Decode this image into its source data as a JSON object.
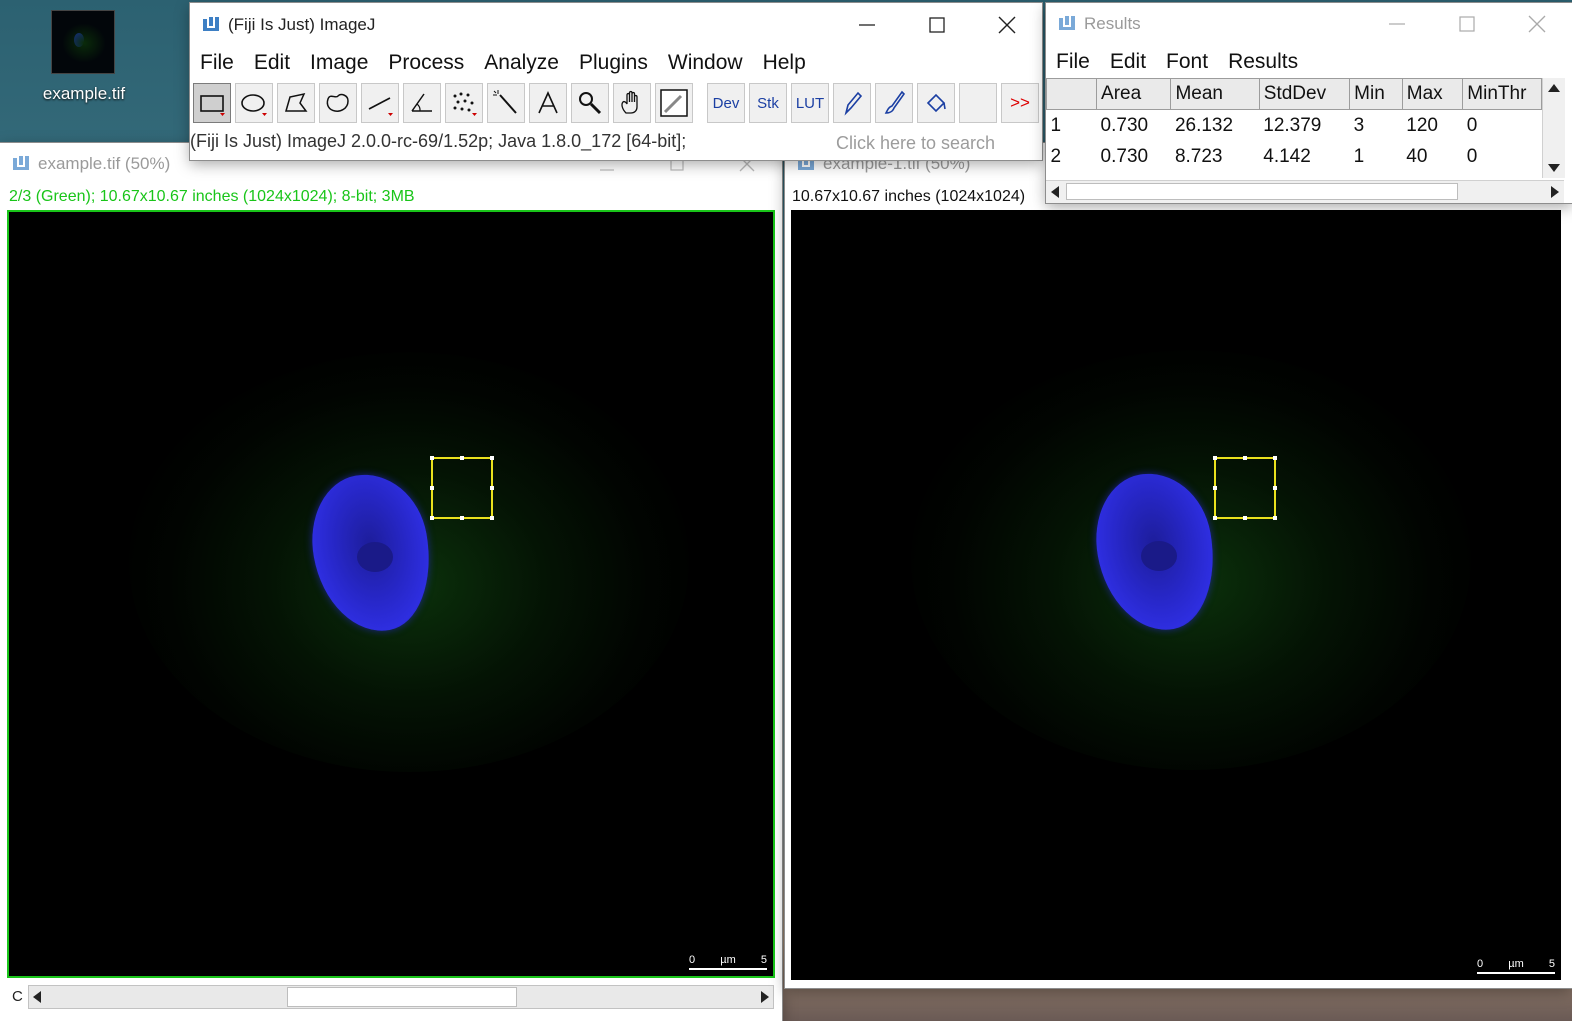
{
  "desktop": {
    "icon_label": "example.tif"
  },
  "imagej": {
    "title": "(Fiji Is Just) ImageJ",
    "menu": [
      "File",
      "Edit",
      "Image",
      "Process",
      "Analyze",
      "Plugins",
      "Window",
      "Help"
    ],
    "tools": {
      "dev": "Dev",
      "stk": "Stk",
      "lut": "LUT",
      "more": ">>"
    },
    "status": "(Fiji Is Just) ImageJ 2.0.0-rc-69/1.52p; Java 1.8.0_172 [64-bit];",
    "search_placeholder": "Click here to search"
  },
  "image_left": {
    "title": "example.tif (50%)",
    "info": "2/3 (Green); 10.67x10.67 inches (1024x1024); 8-bit; 3MB",
    "channel_label": "C",
    "scale": {
      "zero": "0",
      "unit": "µm",
      "max": "5"
    }
  },
  "image_right": {
    "title": "example-1.tif (50%)",
    "info": "10.67x10.67 inches (1024x1024)",
    "scale": {
      "zero": "0",
      "unit": "µm",
      "max": "5"
    }
  },
  "results": {
    "title": "Results",
    "menu": [
      "File",
      "Edit",
      "Font",
      "Results"
    ],
    "columns": [
      "",
      "Area",
      "Mean",
      "StdDev",
      "Min",
      "Max",
      "MinThr"
    ],
    "rows": [
      [
        "1",
        "0.730",
        "26.132",
        "12.379",
        "3",
        "120",
        "0"
      ],
      [
        "2",
        "0.730",
        "8.723",
        "4.142",
        "1",
        "40",
        "0"
      ]
    ]
  },
  "colors": {
    "accent_green": "#19c519",
    "roi_yellow": "#e9e11d",
    "nucleus_blue": "#2a2ad8"
  }
}
